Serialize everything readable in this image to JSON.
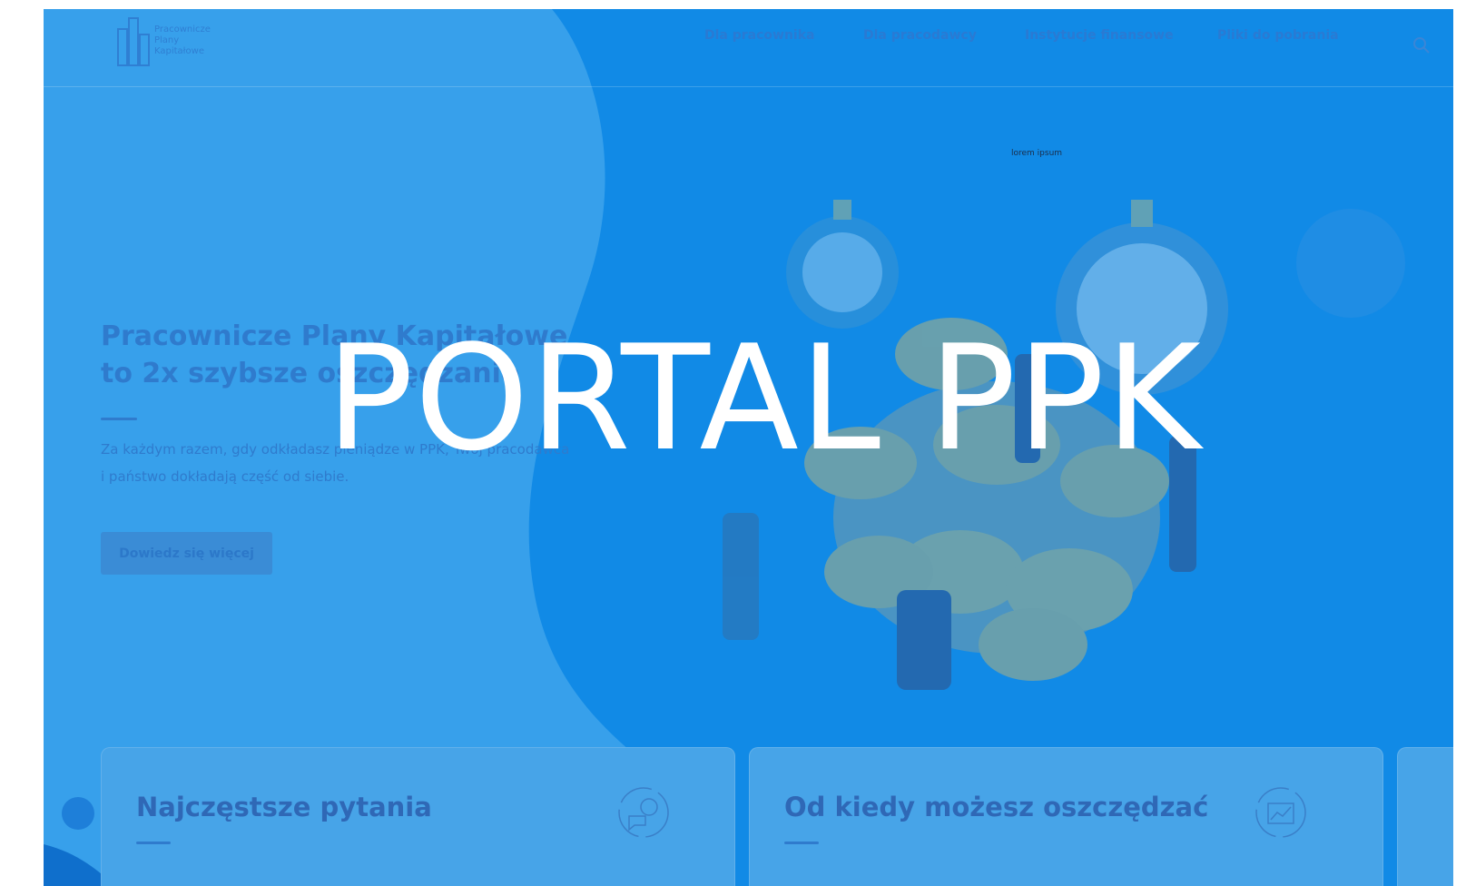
{
  "overlay_title": "PORTAL PPK",
  "logo": {
    "line1": "Pracownicze",
    "line2": "Plany",
    "line3": "Kapitałowe"
  },
  "nav": {
    "items": [
      "Dla pracownika",
      "Dla pracodawcy",
      "Instytucje finansowe",
      "Pliki do pobrania"
    ]
  },
  "hero": {
    "title_line1": "Pracownicze Plany Kapitałowe",
    "title_line2": "to 2x szybsze oszczędzanie",
    "desc_line1": "Za każdym razem, gdy odkładasz pieniądze w PPK, Twój pracodawca",
    "desc_line2": "i państwo dokładają część od siebie.",
    "cta_label": "Dowiedz się więcej",
    "image_caption": "lorem ipsum"
  },
  "cards": [
    {
      "title": "Najczęstsze pytania",
      "icon": "question-chat-icon"
    },
    {
      "title": "Od kiedy możesz oszczędzać",
      "icon": "calendar-chart-icon"
    }
  ],
  "colors": {
    "overlay_blue": "#118ae6",
    "left_blob": "#3aa3ec",
    "overlay_text": "#ffffff"
  }
}
